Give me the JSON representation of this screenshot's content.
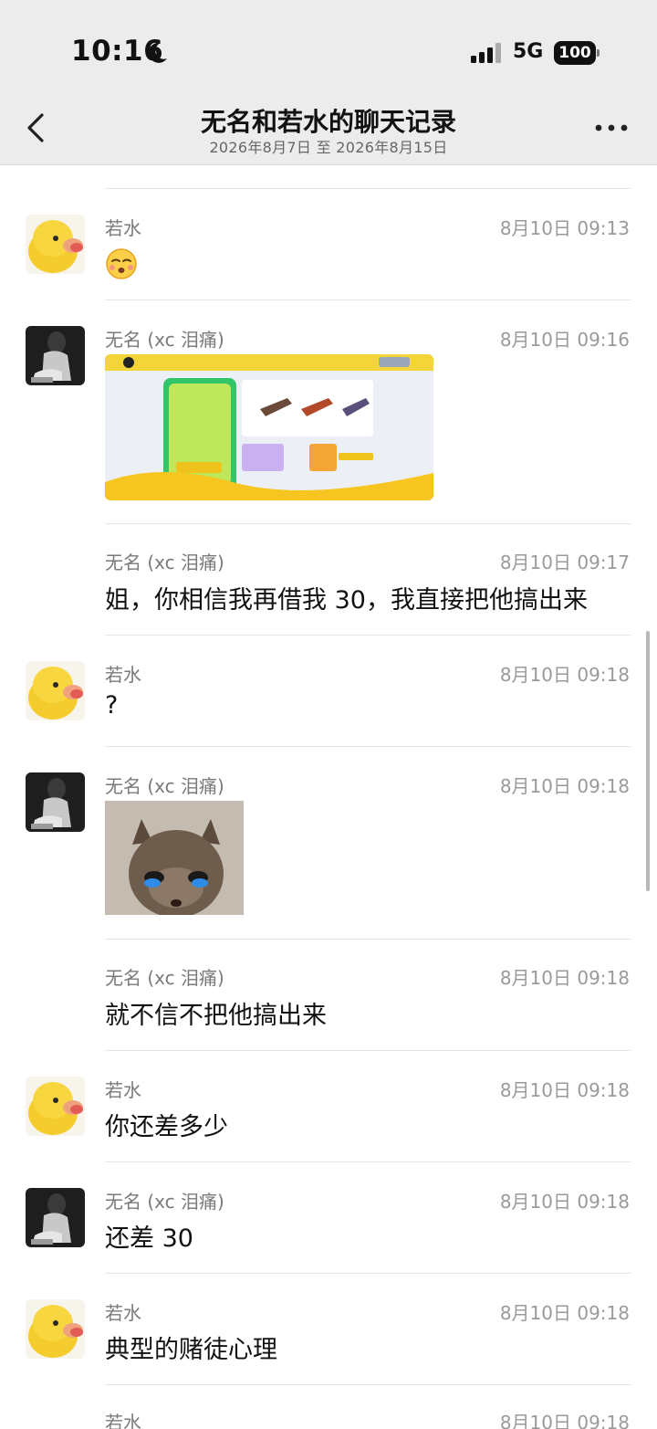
{
  "status": {
    "time": "10:16",
    "network": "5G",
    "battery": "100"
  },
  "header": {
    "title": "无名和若水的聊天记录",
    "subtitle": "2026年8月7日 至 2026年8月15日"
  },
  "messages": [
    {
      "sender": "若水",
      "time": "8月10日 09:13",
      "emoji": "kissing-face-emoji"
    },
    {
      "sender": "无名 (xc 泪痛)",
      "time": "8月10日 09:16",
      "image": "game-screenshot"
    },
    {
      "sender": "无名 (xc 泪痛)",
      "time": "8月10日 09:17",
      "text": "姐，你相信我再借我 30，我直接把他搞出来"
    },
    {
      "sender": "若水",
      "time": "8月10日 09:18",
      "text": "?"
    },
    {
      "sender": "无名 (xc 泪痛)",
      "time": "8月10日 09:18",
      "image": "crying-cat-sticker"
    },
    {
      "sender": "无名 (xc 泪痛)",
      "time": "8月10日 09:18",
      "text": "就不信不把他搞出来"
    },
    {
      "sender": "若水",
      "time": "8月10日 09:18",
      "text": "你还差多少"
    },
    {
      "sender": "无名 (xc 泪痛)",
      "time": "8月10日 09:18",
      "text": "还差 30"
    },
    {
      "sender": "若水",
      "time": "8月10日 09:18",
      "text": "典型的赌徒心理"
    },
    {
      "sender": "若水",
      "time": "8月10日 09:18"
    }
  ],
  "colors": {
    "header_bg": "#ececec",
    "divider": "#e5e5e5",
    "meta_text": "#9a9a9a"
  }
}
